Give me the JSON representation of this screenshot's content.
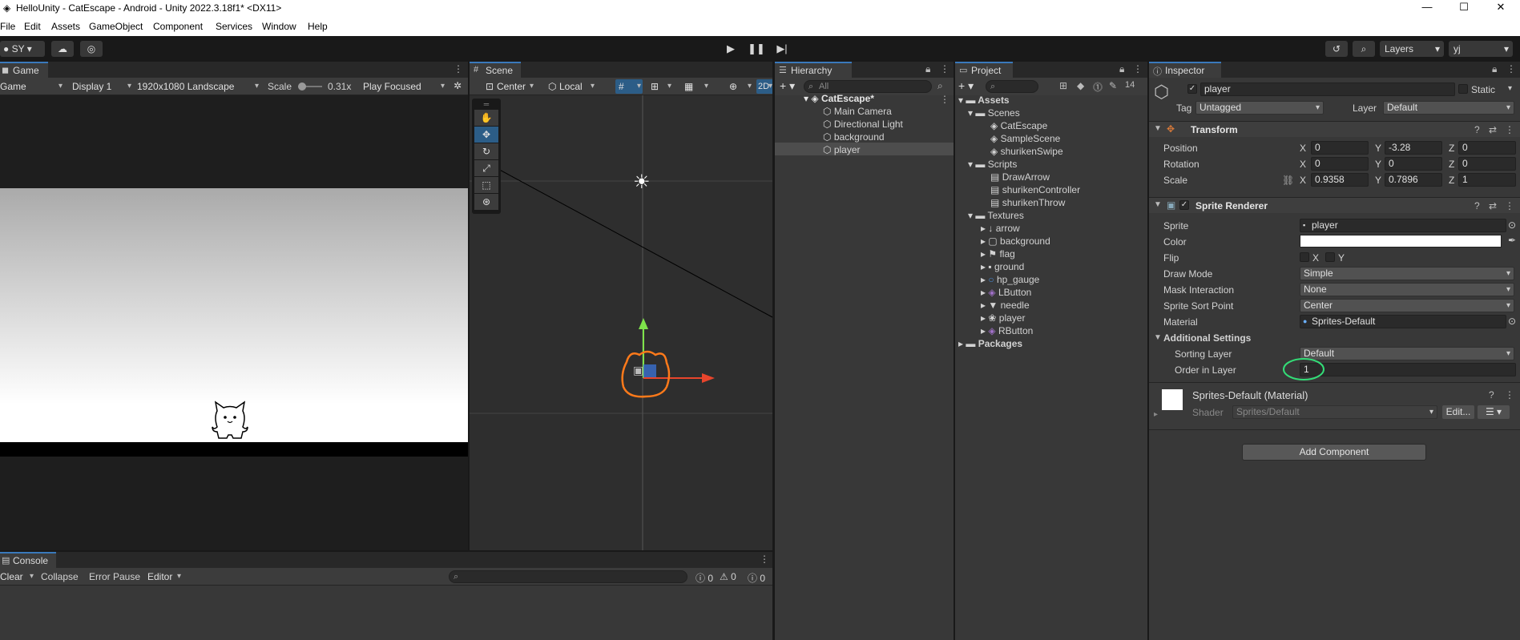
{
  "window": {
    "title": "HelloUnity - CatEscape - Android - Unity 2022.3.18f1* <DX11>",
    "minimize": "—",
    "maximize": "☐",
    "close": "✕"
  },
  "menu": [
    "File",
    "Edit",
    "Assets",
    "GameObject",
    "Component",
    "Services",
    "Window",
    "Help"
  ],
  "toolbar": {
    "account": "SY",
    "layers_label": "Layers",
    "layout_label": "yj"
  },
  "game": {
    "tab": "Game",
    "mode": "Game",
    "display": "Display 1",
    "resolution": "1920x1080 Landscape",
    "scale_label": "Scale",
    "scale_value": "0.31x",
    "play_mode": "Play Focused"
  },
  "scene": {
    "tab": "Scene",
    "pivot": "Center",
    "space": "Local",
    "mode_2d": "2D"
  },
  "hierarchy": {
    "tab": "Hierarchy",
    "search_placeholder": "All",
    "scene": "CatEscape*",
    "items": [
      "Main Camera",
      "Directional Light",
      "background",
      "player"
    ]
  },
  "project": {
    "tab": "Project",
    "badge": "14",
    "assets": "Assets",
    "scenes_folder": "Scenes",
    "scenes": [
      "CatEscape",
      "SampleScene",
      "shurikenSwipe"
    ],
    "scripts_folder": "Scripts",
    "scripts": [
      "DrawArrow",
      "shurikenController",
      "shurikenThrow"
    ],
    "textures_folder": "Textures",
    "textures": [
      "arrow",
      "background",
      "flag",
      "ground",
      "hp_gauge",
      "LButton",
      "needle",
      "player",
      "RButton"
    ],
    "packages": "Packages"
  },
  "inspector": {
    "tab": "Inspector",
    "object_name": "player",
    "static_label": "Static",
    "tag_label": "Tag",
    "tag_value": "Untagged",
    "layer_label": "Layer",
    "layer_value": "Default",
    "transform": {
      "title": "Transform",
      "position_label": "Position",
      "rotation_label": "Rotation",
      "scale_label": "Scale",
      "x": "X",
      "y": "Y",
      "z": "Z",
      "position": [
        "0",
        "-3.28",
        "0"
      ],
      "rotation": [
        "0",
        "0",
        "0"
      ],
      "scale": [
        "0.9358",
        "0.7896",
        "1"
      ]
    },
    "sprite_renderer": {
      "title": "Sprite Renderer",
      "sprite_label": "Sprite",
      "sprite_value": "player",
      "color_label": "Color",
      "flip_label": "Flip",
      "flip_x": "X",
      "flip_y": "Y",
      "draw_mode_label": "Draw Mode",
      "draw_mode_value": "Simple",
      "mask_label": "Mask Interaction",
      "mask_value": "None",
      "sort_point_label": "Sprite Sort Point",
      "sort_point_value": "Center",
      "material_label": "Material",
      "material_value": "Sprites-Default",
      "additional_label": "Additional Settings",
      "sorting_layer_label": "Sorting Layer",
      "sorting_layer_value": "Default",
      "order_label": "Order in Layer",
      "order_value": "1"
    },
    "material": {
      "title": "Sprites-Default (Material)",
      "shader_label": "Shader",
      "shader_value": "Sprites/Default",
      "edit_label": "Edit..."
    },
    "add_component": "Add Component"
  },
  "console": {
    "tab": "Console",
    "clear": "Clear",
    "collapse": "Collapse",
    "error_pause": "Error Pause",
    "editor": "Editor",
    "counts": [
      "0",
      "0",
      "0"
    ]
  },
  "colors": {
    "accent": "#3a79bb",
    "selection": "#2c5d87",
    "panel": "#383838",
    "dark": "#191919",
    "highlight_circle": "#33dd77"
  }
}
